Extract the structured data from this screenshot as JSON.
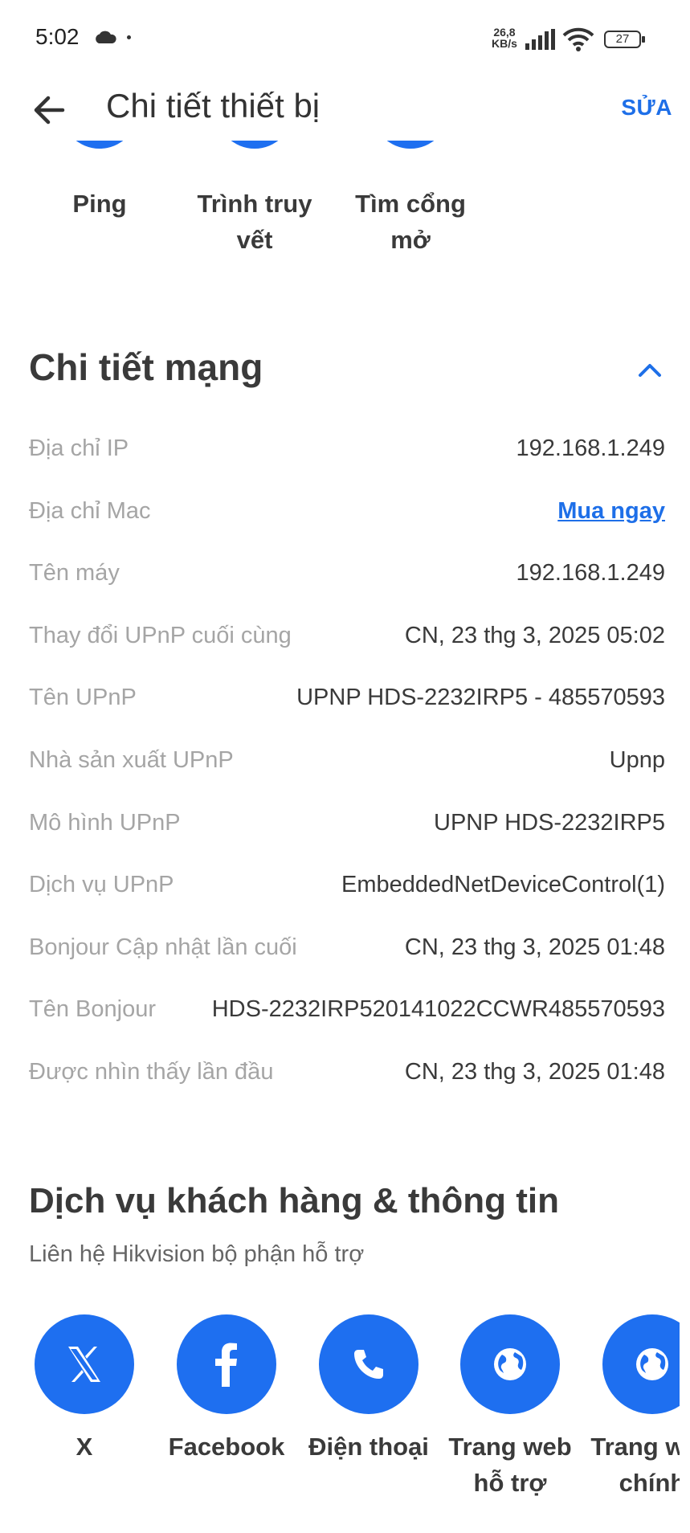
{
  "status": {
    "time": "5:02",
    "speed_top": "26,8",
    "speed_bottom": "KB/s",
    "battery": "27"
  },
  "header": {
    "title": "Chi tiết thiết bị",
    "edit_label": "SỬA"
  },
  "tools": [
    {
      "label": "Ping"
    },
    {
      "label": "Trình truy vết"
    },
    {
      "label": "Tìm cổng mở"
    }
  ],
  "network": {
    "title": "Chi tiết mạng",
    "rows": [
      {
        "label": "Địa chỉ IP",
        "value": "192.168.1.249"
      },
      {
        "label": "Địa chỉ Mac",
        "value": "Mua ngay"
      },
      {
        "label": "Tên máy",
        "value": "192.168.1.249"
      },
      {
        "label": "Thay đổi UPnP cuối cùng",
        "value": "CN, 23 thg 3, 2025 05:02"
      },
      {
        "label": "Tên UPnP",
        "value": "UPNP HDS-2232IRP5 - 485570593"
      },
      {
        "label": "Nhà sản xuất UPnP",
        "value": "Upnp"
      },
      {
        "label": "Mô hình UPnP",
        "value": "UPNP HDS-2232IRP5"
      },
      {
        "label": "Dịch vụ UPnP",
        "value": "EmbeddedNetDeviceControl(1)"
      },
      {
        "label": "Bonjour Cập nhật lần cuối",
        "value": "CN, 23 thg 3, 2025 01:48"
      },
      {
        "label": "Tên Bonjour",
        "value": "HDS-2232IRP520141022CCWR485570593"
      },
      {
        "label": "Được nhìn thấy lần đầu",
        "value": "CN, 23 thg 3, 2025 01:48"
      }
    ]
  },
  "customer_service": {
    "title": "Dịch vụ khách hàng & thông tin",
    "subtitle": "Liên hệ Hikvision bộ phận hỗ trợ",
    "contacts": [
      {
        "label": "X",
        "icon": "x-logo-icon"
      },
      {
        "label": "Facebook",
        "icon": "facebook-icon"
      },
      {
        "label": "Điện thoại",
        "icon": "phone-icon"
      },
      {
        "label": "Trang web hỗ trợ",
        "icon": "globe-icon"
      },
      {
        "label": "Trang web chính",
        "icon": "globe-icon"
      }
    ]
  },
  "colors": {
    "accent": "#1e6fe8",
    "circle": "#1e6ff0",
    "label_gray": "#a5a5a5",
    "text": "#3a3a3a"
  }
}
